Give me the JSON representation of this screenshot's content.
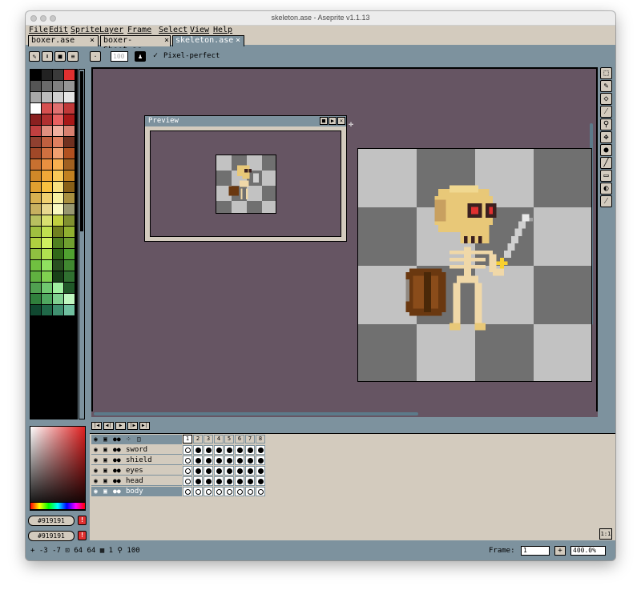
{
  "window": {
    "title": "skeleton.ase - Aseprite v1.1.13"
  },
  "menu": [
    "File",
    "Edit",
    "Sprite",
    "Layer",
    "Frame",
    "Select",
    "View",
    "Help"
  ],
  "tabs": [
    {
      "label": "boxer.ase",
      "close": "×",
      "active": false
    },
    {
      "label": "boxer-Sheet.as",
      "close": "×",
      "active": false
    },
    {
      "label": "skeleton.ase",
      "close": "×",
      "active": true
    }
  ],
  "toolbar": {
    "brush_size": "100",
    "pixel_perfect_check": "✓",
    "pixel_perfect_label": "Pixel-perfect"
  },
  "preview": {
    "title": "Preview"
  },
  "color_buttons": [
    {
      "label": "#919191",
      "warn": "!"
    },
    {
      "label": "#919191",
      "warn": "!"
    }
  ],
  "timeline": {
    "frames": [
      "1",
      "2",
      "3",
      "4",
      "5",
      "6",
      "7",
      "8"
    ],
    "layers": [
      {
        "name": "sword",
        "selected": false,
        "cels": [
          "ring",
          "dot",
          "dot",
          "dot",
          "dot",
          "dot",
          "dot",
          "dot"
        ]
      },
      {
        "name": "shield",
        "selected": false,
        "cels": [
          "ring",
          "dot",
          "dot",
          "dot",
          "dot",
          "dot",
          "dot",
          "dot"
        ]
      },
      {
        "name": "eyes",
        "selected": false,
        "cels": [
          "ring",
          "dot",
          "dot",
          "dot",
          "dot",
          "dot",
          "dot",
          "dot"
        ]
      },
      {
        "name": "head",
        "selected": false,
        "cels": [
          "ring",
          "dot",
          "dot",
          "dot",
          "dot",
          "dot",
          "dot",
          "dot"
        ]
      },
      {
        "name": "body",
        "selected": true,
        "cels": [
          "ring",
          "ring",
          "ring",
          "ring",
          "ring",
          "ring",
          "ring",
          "ring"
        ]
      }
    ],
    "onion_label": "1:1"
  },
  "status": {
    "position": "-3 -7",
    "size": "64 64",
    "frame_count": "1",
    "zoom_pct": "100",
    "frame_label": "Frame:",
    "frame_value": "1",
    "plus": "+",
    "zoom_value": "400.0%"
  },
  "palette": [
    "#000000",
    "#222222",
    "#3a3a3a",
    "#e03030",
    "#555555",
    "#6b6b6b",
    "#808080",
    "#959595",
    "#a8a8a8",
    "#bcbcbc",
    "#d0d0d0",
    "#e4e4e4",
    "#ffffff",
    "#d65050",
    "#e07070",
    "#c03838",
    "#8a2020",
    "#b03030",
    "#e86060",
    "#a81818",
    "#c04040",
    "#e09080",
    "#f0b0a0",
    "#d88070",
    "#904030",
    "#c06040",
    "#e08060",
    "#703020",
    "#a04828",
    "#d07040",
    "#f0a070",
    "#b05020",
    "#c87030",
    "#e89040",
    "#f8b050",
    "#a06020",
    "#d08828",
    "#f0a838",
    "#f8c858",
    "#c08020",
    "#e0a030",
    "#f8c040",
    "#f8e080",
    "#886018",
    "#d8b050",
    "#f0d070",
    "#f8f0a0",
    "#a89040",
    "#c8b060",
    "#e8d890",
    "#f8f8c0",
    "#989870",
    "#b8c060",
    "#d8e070",
    "#c0d040",
    "#809030",
    "#a0c040",
    "#c0e050",
    "#708020",
    "#90b030",
    "#b0d040",
    "#d0f060",
    "#508020",
    "#70a030",
    "#90c040",
    "#b0e050",
    "#306818",
    "#50a030",
    "#70c040",
    "#90e060",
    "#285020",
    "#408830",
    "#60b040",
    "#80d050",
    "#184018",
    "#307030",
    "#50a050",
    "#70c870",
    "#a0f0a0",
    "#205828",
    "#30803c",
    "#50a860",
    "#80d090",
    "#c0f8c0",
    "#104830",
    "#206848",
    "#409070",
    "#70c0a0"
  ]
}
